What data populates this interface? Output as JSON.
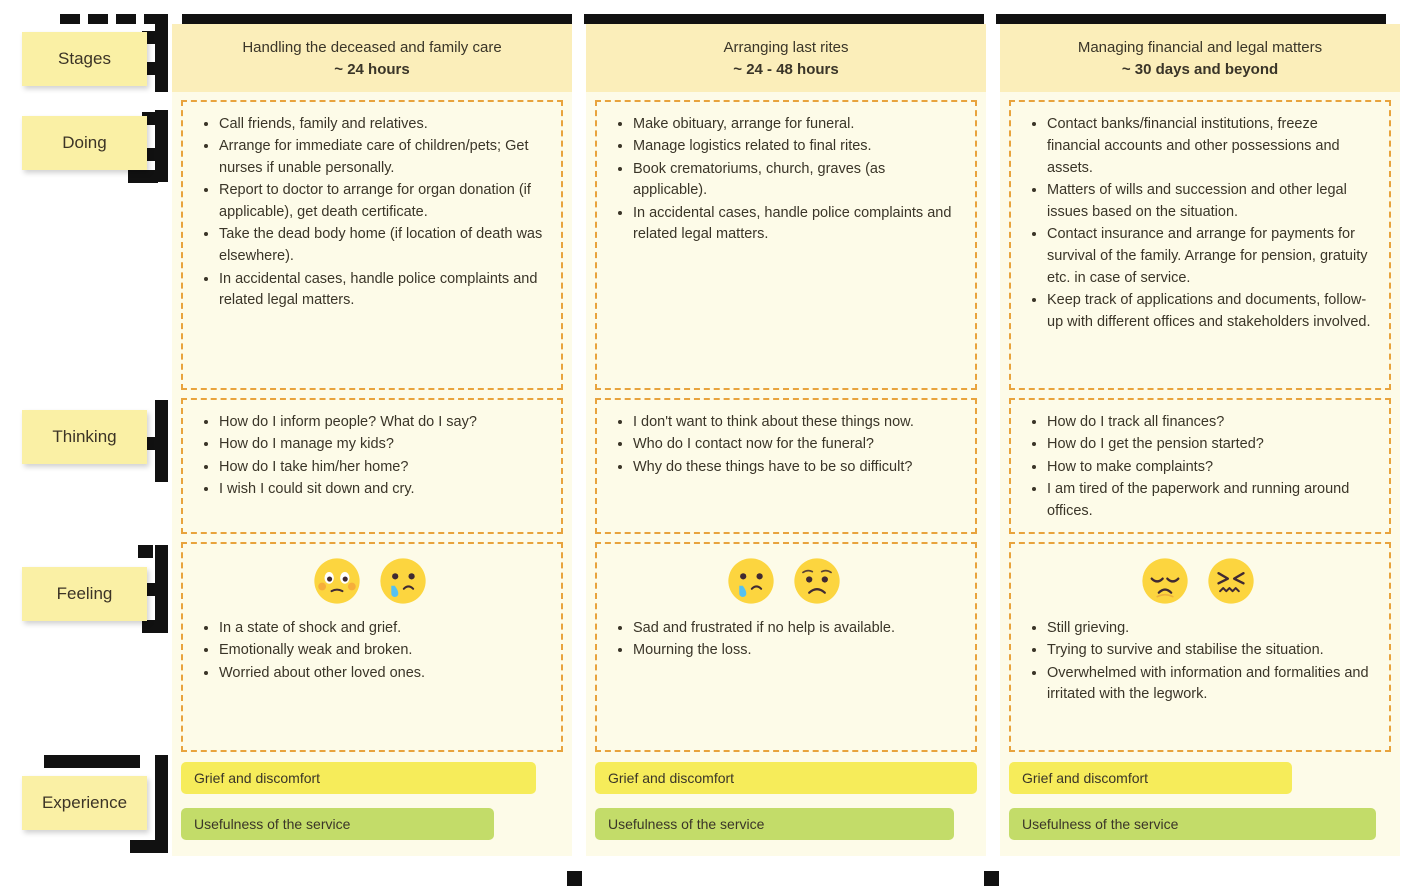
{
  "sidebar": {
    "rows": [
      {
        "label": "Stages"
      },
      {
        "label": "Doing"
      },
      {
        "label": "Thinking"
      },
      {
        "label": "Feeling"
      },
      {
        "label": "Experience"
      }
    ]
  },
  "colors": {
    "column_background": "#fdfbe8",
    "header_background": "#fbeeba",
    "chip_background": "#faf0a5",
    "dashed_border": "#e8a33d",
    "grief_bar": "#f6ec5a",
    "useful_bar": "#c3dc69",
    "frame": "#111111",
    "text": "#3a3528"
  },
  "columns": [
    {
      "header": {
        "title": "Handling the deceased and family care",
        "duration": "~ 24 hours"
      },
      "doing": [
        "Call friends, family and relatives.",
        "Arrange for immediate care of children/pets; Get nurses if unable personally.",
        "Report to doctor to arrange for organ donation (if applicable), get death certificate.",
        "Take the dead body home (if location of death was elsewhere).",
        "In accidental cases, handle police complaints and related legal matters."
      ],
      "thinking": [
        "How do I inform people? What do I say?",
        "How do I manage my kids?",
        "How do I take him/her home?",
        "I wish I could sit down and cry."
      ],
      "feeling": {
        "emojis": [
          "shocked-blush-face-icon",
          "crying-face-icon"
        ],
        "items": [
          "In a state of shock and grief.",
          "Emotionally weak and broken.",
          "Worried about other loved ones."
        ]
      },
      "experience": {
        "grief_label": "Grief and discomfort",
        "grief_width_pct": 93,
        "useful_label": "Usefulness of the service",
        "useful_width_pct": 82
      }
    },
    {
      "header": {
        "title": "Arranging last rites",
        "duration": "~ 24 - 48 hours"
      },
      "doing": [
        "Make obituary, arrange for funeral.",
        "Manage logistics related to final rites.",
        "Book crematoriums, church, graves (as applicable).",
        "In accidental cases, handle police complaints and related legal matters."
      ],
      "thinking": [
        "I don't want to think about these things now.",
        "Who do I contact now for the funeral?",
        "Why do these things have to be so difficult?"
      ],
      "feeling": {
        "emojis": [
          "crying-face-icon",
          "frowning-face-icon"
        ],
        "items": [
          "Sad and frustrated if no help is available.",
          "Mourning the loss."
        ]
      },
      "experience": {
        "grief_label": "Grief and discomfort",
        "grief_width_pct": 100,
        "useful_label": "Usefulness of the service",
        "useful_width_pct": 94
      }
    },
    {
      "header": {
        "title": "Managing financial and legal matters",
        "duration": "~ 30 days and beyond"
      },
      "doing": [
        "Contact banks/financial institutions, freeze financial accounts and other possessions and assets.",
        "Matters of wills and succession and other legal issues based on the situation.",
        "Contact insurance and arrange for payments for survival of the family. Arrange for pension, gratuity etc. in case of service.",
        "Keep track of applications and documents, follow-up with different offices and stakeholders involved."
      ],
      "thinking": [
        "How do I track all finances?",
        "How do I get the pension started?",
        "How to make complaints?",
        "I am tired of the paperwork and running around offices."
      ],
      "feeling": {
        "emojis": [
          "pensive-face-icon",
          "confounded-face-icon"
        ],
        "items": [
          "Still grieving.",
          "Trying to survive and stabilise the situation.",
          "Overwhelmed with information and formalities and irritated with the legwork."
        ]
      },
      "experience": {
        "grief_label": "Grief and discomfort",
        "grief_width_pct": 74,
        "useful_label": "Usefulness of the service",
        "useful_width_pct": 96
      }
    }
  ]
}
